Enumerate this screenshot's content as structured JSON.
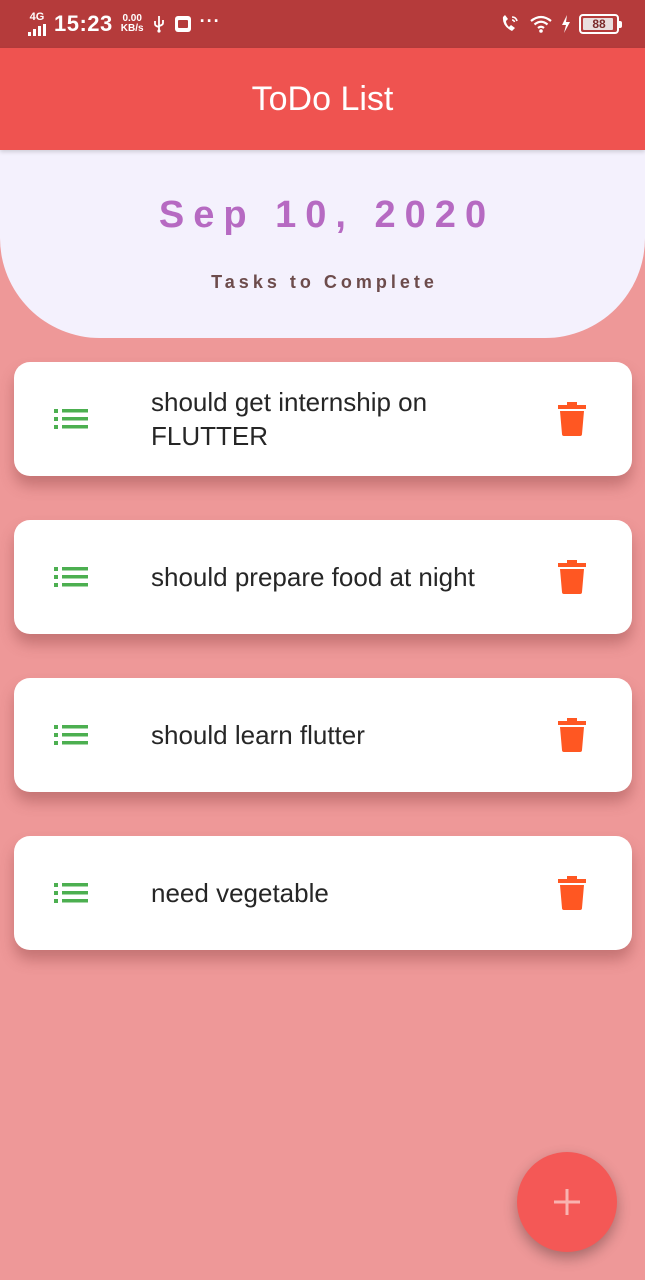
{
  "status_bar": {
    "network": "4G",
    "time": "15:23",
    "speed_value": "0.00",
    "speed_unit": "KB/s",
    "battery": "88"
  },
  "app_bar": {
    "title": "ToDo List"
  },
  "header": {
    "date": "Sep 10, 2020",
    "subtitle": "Tasks to Complete"
  },
  "tasks": [
    {
      "text": "should get internship on FLUTTER"
    },
    {
      "text": "should prepare food at night"
    },
    {
      "text": "should learn flutter"
    },
    {
      "text": "need vegetable"
    }
  ],
  "icons": {
    "task": "list-icon",
    "delete": "delete-icon",
    "add": "add-icon"
  },
  "colors": {
    "status_bar": "#b53b3b",
    "app_bar": "#ef5350",
    "background": "#ee9898",
    "header_card": "#f4f1fd",
    "date_text": "#b66ac2",
    "list_icon": "#4caf50",
    "delete_icon": "#ff5722",
    "fab": "#f45856"
  }
}
